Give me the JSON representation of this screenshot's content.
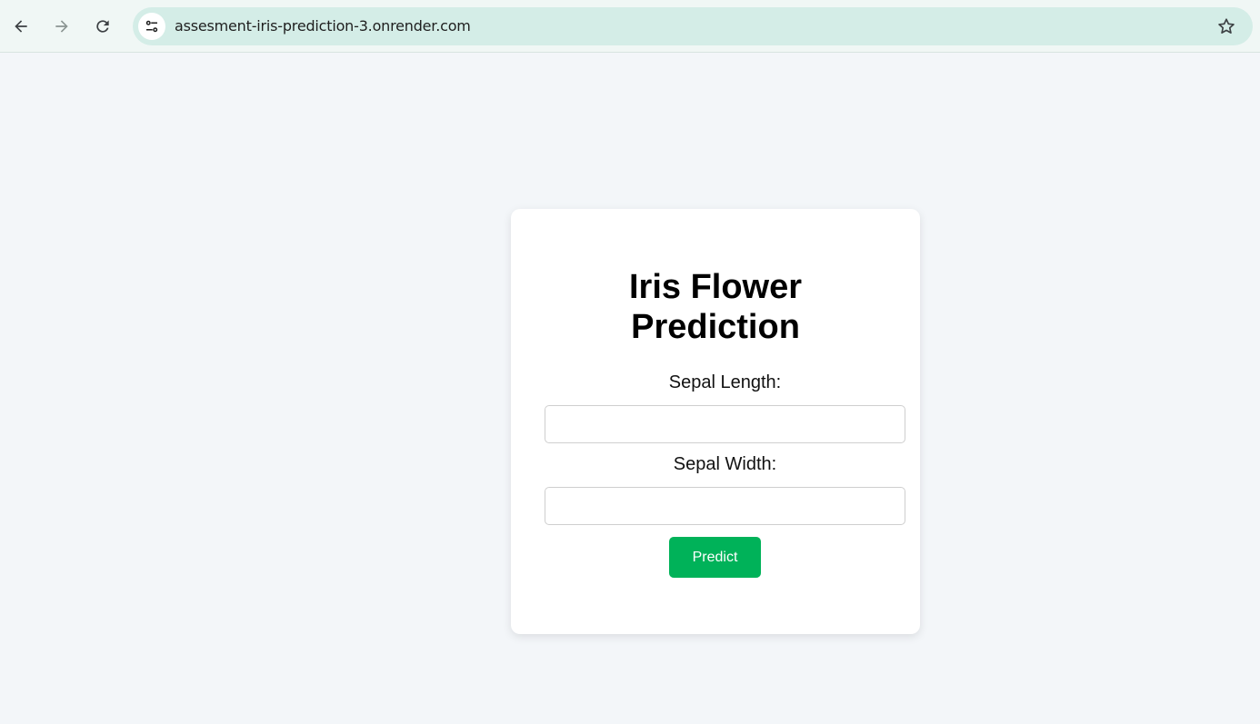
{
  "browser": {
    "url": "assesment-iris-prediction-3.onrender.com",
    "icons": {
      "back": "arrow-left-icon",
      "forward": "arrow-right-icon",
      "reload": "reload-icon",
      "site_info": "tune-icon",
      "bookmark": "star-icon"
    }
  },
  "form": {
    "title_line1": "Iris Flower",
    "title_line2": "Prediction",
    "sepal_length_label": "Sepal Length:",
    "sepal_length_value": "",
    "sepal_width_label": "Sepal Width:",
    "sepal_width_value": "",
    "predict_label": "Predict"
  },
  "colors": {
    "page_background": "#f3f6f9",
    "card_background": "#ffffff",
    "button_background": "#00b259",
    "button_text": "#ffffff",
    "omnibox": "#d4ede7"
  }
}
